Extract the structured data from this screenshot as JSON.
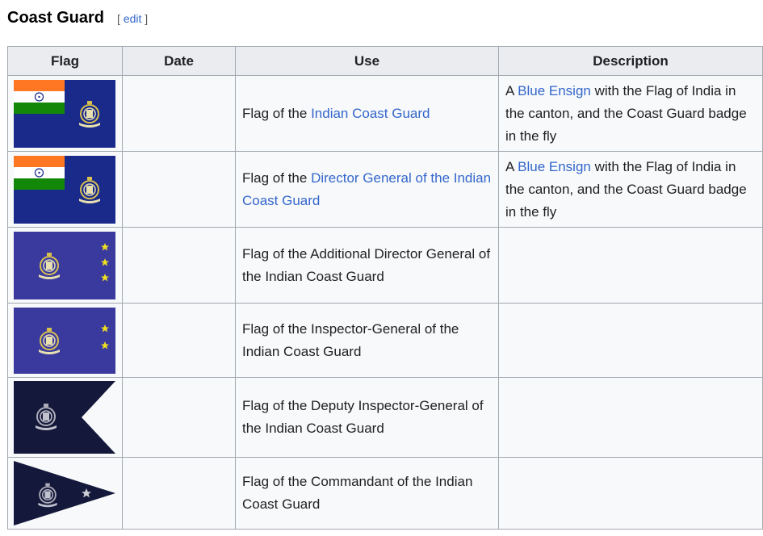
{
  "section": {
    "title": "Coast Guard",
    "edit_open": "[",
    "edit_label": "edit",
    "edit_close": "]"
  },
  "table": {
    "headers": [
      "Flag",
      "Date",
      "Use",
      "Description"
    ],
    "rows": [
      {
        "flag_icon": "ensign-flag-icon",
        "date": "",
        "use_prefix": "Flag of the ",
        "use_link": "Indian Coast Guard",
        "use_suffix": "",
        "desc_prefix": "A ",
        "desc_link": "Blue Ensign",
        "desc_suffix": " with the Flag of India in the canton, and the Coast Guard badge in the fly"
      },
      {
        "flag_icon": "ensign-flag-icon",
        "date": "",
        "use_prefix": "Flag of the ",
        "use_link": "Director General of the Indian Coast Guard",
        "use_suffix": "",
        "desc_prefix": "A ",
        "desc_link": "Blue Ensign",
        "desc_suffix": " with the Flag of India in the canton, and the Coast Guard badge in the fly"
      },
      {
        "flag_icon": "three-star-flag-icon",
        "date": "",
        "use_text": "Flag of the Additional Director General of the Indian Coast Guard",
        "description": ""
      },
      {
        "flag_icon": "two-star-flag-icon",
        "date": "",
        "use_text": "Flag of the Inspector-General of the Indian Coast Guard",
        "description": ""
      },
      {
        "flag_icon": "swallowtail-pennant-icon",
        "date": "",
        "use_text": "Flag of the Deputy Inspector-General of the Indian Coast Guard",
        "description": ""
      },
      {
        "flag_icon": "triangular-pennant-icon",
        "date": "",
        "use_text": "Flag of the Commandant of the Indian Coast Guard",
        "description": ""
      }
    ]
  },
  "colors": {
    "link": "#3366cc",
    "header_bg": "#eaecf0",
    "cell_bg": "#f8f9fa",
    "border": "#a2a9b1",
    "ensign_blue": "#1a2a8a",
    "flag_violet": "#3a3a9e",
    "pennant_navy": "#14183a",
    "saffron": "#ff7722",
    "india_green": "#138808",
    "star_yellow": "#f0e020"
  }
}
